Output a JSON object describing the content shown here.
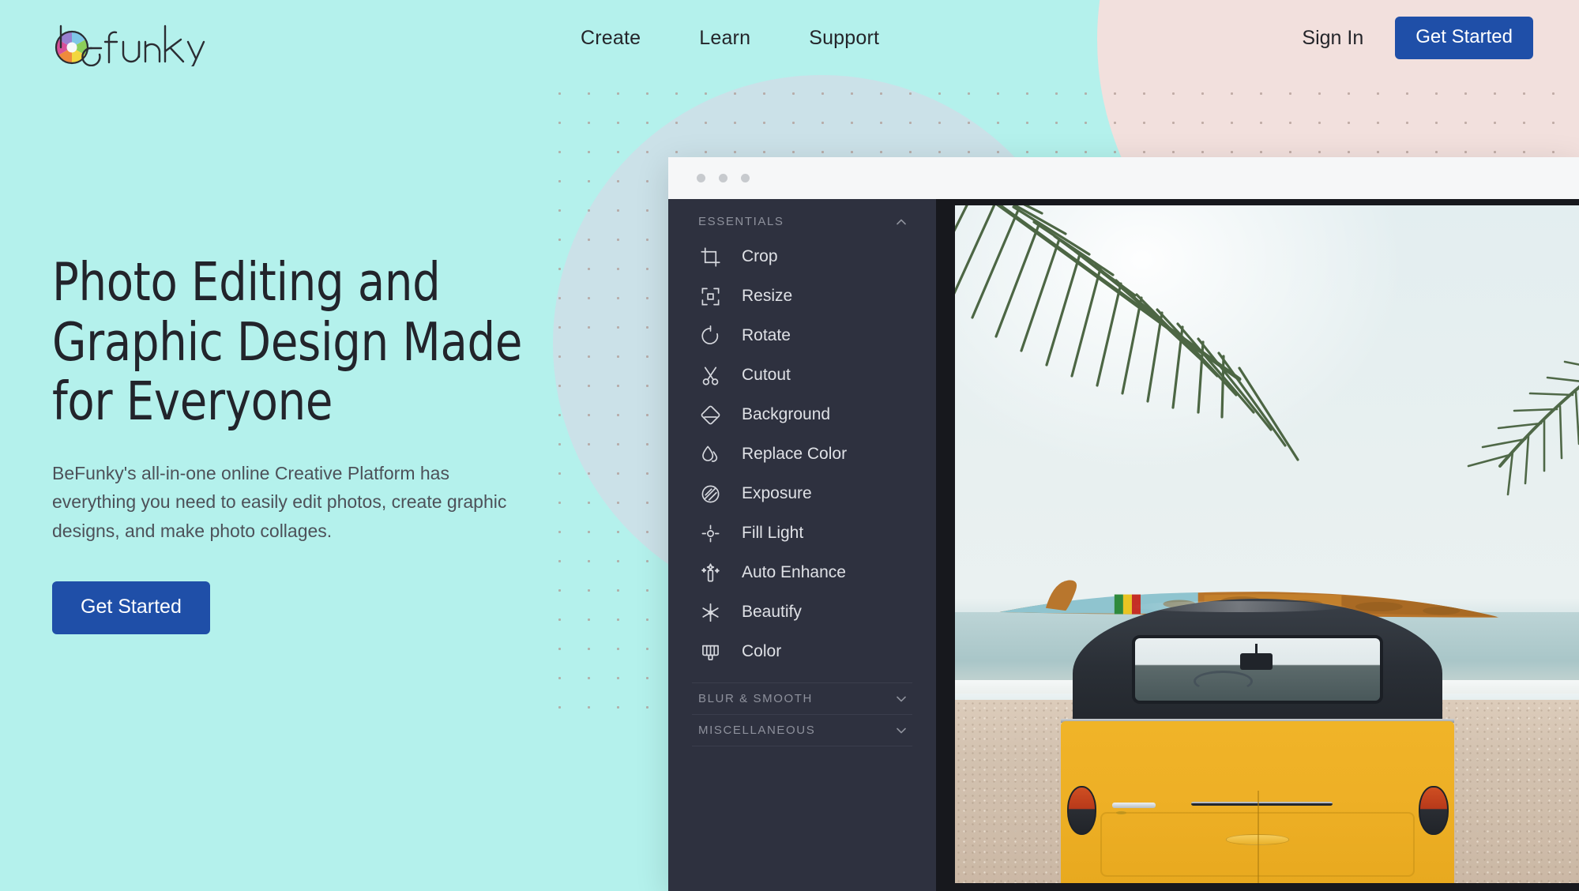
{
  "brand": {
    "name": "befunky",
    "logo_icon": "aperture-icon"
  },
  "nav": {
    "links": [
      {
        "label": "Create"
      },
      {
        "label": "Learn"
      },
      {
        "label": "Support"
      }
    ],
    "signin_label": "Sign In",
    "cta_label": "Get Started",
    "cta_color": "#1f4fa8"
  },
  "hero": {
    "title_line1": "Photo Editing and",
    "title_line2": "Graphic Design Made",
    "title_line3": "for Everyone",
    "subtitle": "BeFunky's all-in-one online Creative Platform has everything you need to easily edit photos, create graphic designs, and make photo collages.",
    "cta_label": "Get Started",
    "cta_color": "#1f4fa8"
  },
  "background": {
    "page_color": "#b4f1ec",
    "pink_blob_color": "#f2e0dd",
    "blue_blob_color": "#cfdee8",
    "dot_color": "#b09a94"
  },
  "editor": {
    "titlebar": {
      "dots": 3,
      "background": "#f6f7f8"
    },
    "sidebar_background": "#2e313f",
    "sections": [
      {
        "title": "ESSENTIALS",
        "expanded": true,
        "chevron": "chevron-up-icon",
        "tools": [
          {
            "label": "Crop",
            "icon": "crop-icon"
          },
          {
            "label": "Resize",
            "icon": "resize-icon"
          },
          {
            "label": "Rotate",
            "icon": "rotate-icon"
          },
          {
            "label": "Cutout",
            "icon": "scissors-icon"
          },
          {
            "label": "Background",
            "icon": "background-icon"
          },
          {
            "label": "Replace Color",
            "icon": "droplet-icon"
          },
          {
            "label": "Exposure",
            "icon": "exposure-icon"
          },
          {
            "label": "Fill Light",
            "icon": "fill-light-icon"
          },
          {
            "label": "Auto Enhance",
            "icon": "magic-wand-icon"
          },
          {
            "label": "Beautify",
            "icon": "beautify-icon"
          },
          {
            "label": "Color",
            "icon": "color-palette-icon"
          }
        ]
      },
      {
        "title": "BLUR & SMOOTH",
        "expanded": false,
        "chevron": "chevron-down-icon",
        "tools": []
      },
      {
        "title": "MISCELLANEOUS",
        "expanded": false,
        "chevron": "chevron-down-icon",
        "tools": []
      }
    ],
    "canvas": {
      "background": "#17181d",
      "photo_description": "Yellow Volkswagen camper van rear view on a beach with a weathered surfboard on the roof, palm fronds and ocean"
    }
  }
}
